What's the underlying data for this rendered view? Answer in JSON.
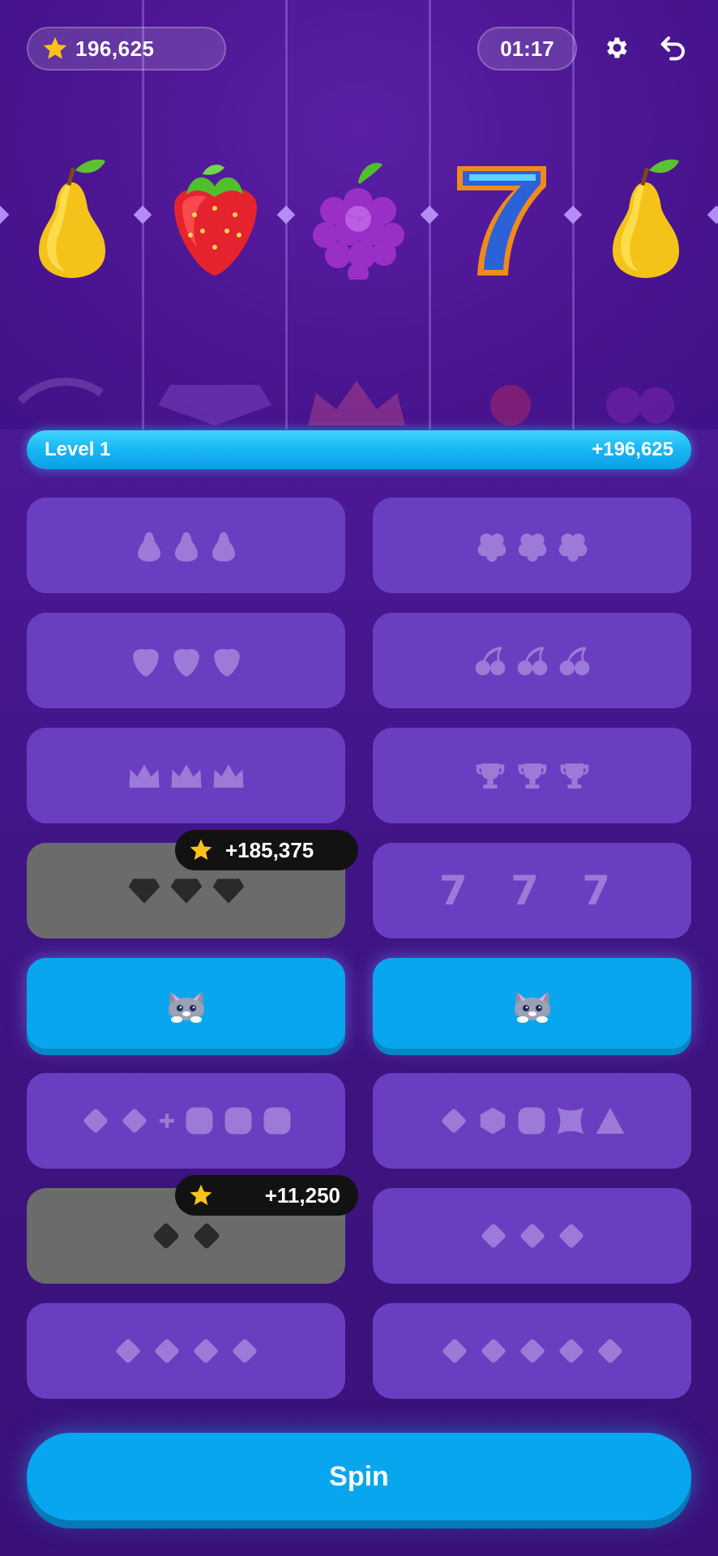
{
  "header": {
    "score": "196,625",
    "timer": "01:17",
    "icons": [
      "star-icon",
      "gear-icon",
      "undo-icon"
    ]
  },
  "level": {
    "label": "Level 1",
    "reward": "+196,625"
  },
  "reels": [
    "pear",
    "strawberry",
    "grapes",
    "seven",
    "pear"
  ],
  "combos": [
    {
      "symbols": "pear pear pear",
      "state": "locked"
    },
    {
      "symbols": "raspberry raspberry raspberry",
      "state": "locked"
    },
    {
      "symbols": "strawberry strawberry strawberry",
      "state": "locked"
    },
    {
      "symbols": "cherry cherry cherry",
      "state": "locked"
    },
    {
      "symbols": "crown crown crown",
      "state": "locked"
    },
    {
      "symbols": "trophy trophy trophy",
      "state": "locked"
    },
    {
      "symbols": "diamond diamond diamond",
      "state": "claimed",
      "reward": "+185,375"
    },
    {
      "symbols": "7 7 7",
      "state": "locked",
      "text": "7 7 7"
    },
    {
      "symbols": "cat",
      "state": "active"
    },
    {
      "symbols": "cat",
      "state": "active"
    },
    {
      "symbols": "2 diamonds + 3 squares",
      "state": "locked"
    },
    {
      "symbols": "diamond hexagon square star triangle",
      "state": "locked"
    },
    {
      "symbols": "2 diamonds",
      "state": "claimed",
      "reward": "+11,250"
    },
    {
      "symbols": "3 diamonds",
      "state": "locked"
    },
    {
      "symbols": "4 diamonds",
      "state": "locked"
    },
    {
      "symbols": "5 diamonds",
      "state": "locked"
    }
  ],
  "spin_label": "Spin",
  "colors": {
    "accent": "#07a6ef",
    "panel": "#6a3ec0",
    "claimed": "#6b6b6b",
    "bg": "#4a1590"
  }
}
